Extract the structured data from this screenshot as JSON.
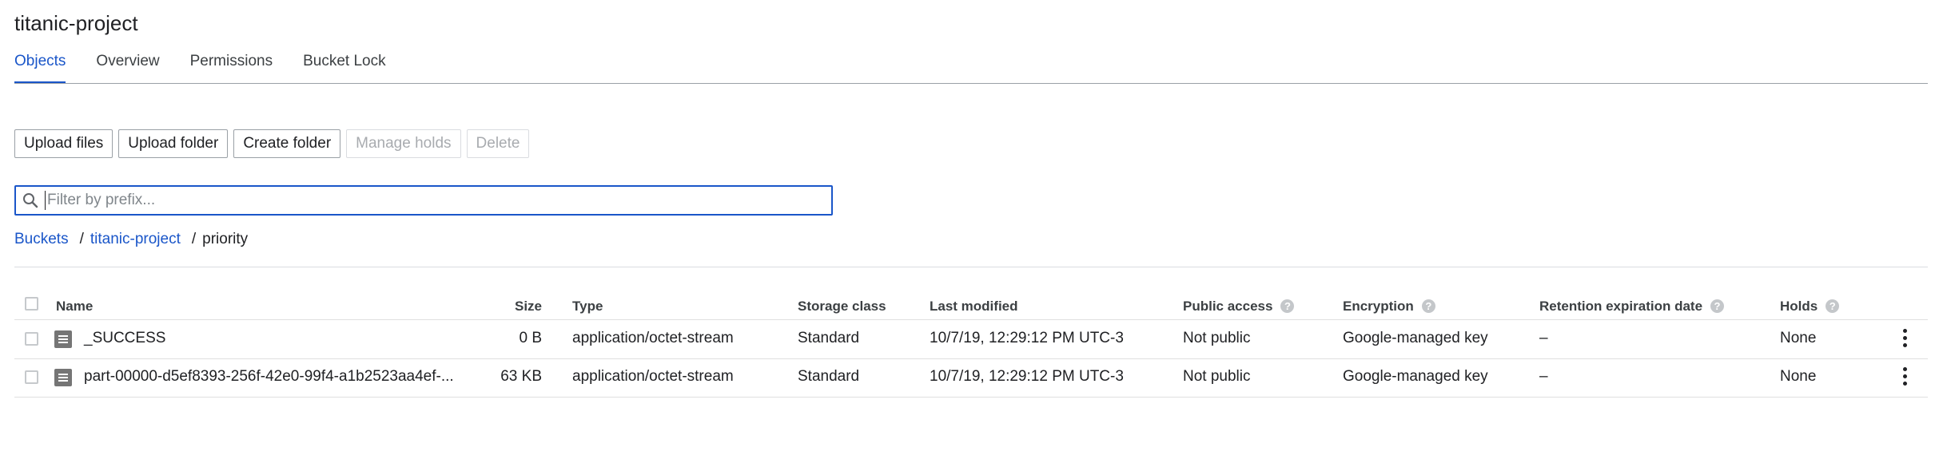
{
  "bucket_title": "titanic-project",
  "tabs": [
    {
      "label": "Objects",
      "active": true
    },
    {
      "label": "Overview",
      "active": false
    },
    {
      "label": "Permissions",
      "active": false
    },
    {
      "label": "Bucket Lock",
      "active": false
    }
  ],
  "toolbar": {
    "upload_files": "Upload files",
    "upload_folder": "Upload folder",
    "create_folder": "Create folder",
    "manage_holds": "Manage holds",
    "delete": "Delete"
  },
  "search": {
    "placeholder": "Filter by prefix...",
    "value": ""
  },
  "breadcrumb": {
    "root": "Buckets",
    "bucket": "titanic-project",
    "current": "priority",
    "separator": "/"
  },
  "table": {
    "headers": {
      "name": "Name",
      "size": "Size",
      "type": "Type",
      "storage_class": "Storage class",
      "last_modified": "Last modified",
      "public_access": "Public access",
      "encryption": "Encryption",
      "retention": "Retention expiration date",
      "holds": "Holds"
    },
    "rows": [
      {
        "name": "_SUCCESS",
        "size": "0 B",
        "type": "application/octet-stream",
        "storage_class": "Standard",
        "last_modified": "10/7/19, 12:29:12 PM UTC-3",
        "public_access": "Not public",
        "encryption": "Google-managed key",
        "retention": "–",
        "holds": "None"
      },
      {
        "name": "part-00000-d5ef8393-256f-42e0-99f4-a1b2523aa4ef-...",
        "size": "63 KB",
        "type": "application/octet-stream",
        "storage_class": "Standard",
        "last_modified": "10/7/19, 12:29:12 PM UTC-3",
        "public_access": "Not public",
        "encryption": "Google-managed key",
        "retention": "–",
        "holds": "None"
      }
    ]
  },
  "colors": {
    "accent": "#1a56c9",
    "text": "#202124",
    "disabled": "#a8abaf"
  },
  "icons": [
    "search-icon",
    "help-icon",
    "file-icon",
    "more-vert-icon",
    "checkbox"
  ]
}
